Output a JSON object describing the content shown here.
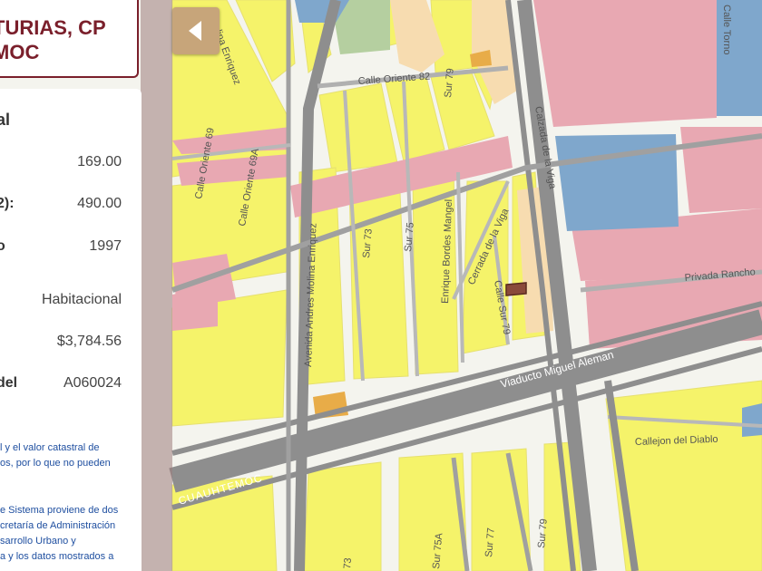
{
  "title": {
    "line1": "TURIAS, CP",
    "line2": "MOC"
  },
  "panel": {
    "heading": "al",
    "rows": [
      {
        "label": "",
        "value": "169.00"
      },
      {
        "label": "2):",
        "value": "490.00"
      },
      {
        "label": "o",
        "value": "1997"
      },
      {
        "label": "",
        "value": "Habitacional"
      },
      {
        "label": "",
        "value": "$3,784.56"
      },
      {
        "label": "del",
        "value": "A060024"
      }
    ],
    "note1": [
      "l y el valor catastral de",
      "os, por lo que no pueden"
    ],
    "note2": [
      "e Sistema proviene de dos",
      "cretaría de Administración",
      "sarrollo Urbano y",
      "a y los datos mostrados a"
    ]
  },
  "map_labels": {
    "calle_oriente_82": "Calle Oriente 82",
    "calle_oriente_69": "Calle Oriente 69",
    "calle_oriente_69a": "Calle Oriente 69A",
    "molina_enriquez_top": "Molina Enriquez",
    "avenida_andres_molina": "Avenida Andres Molina Enriquez",
    "sur_73": "Sur 73",
    "sur_75": "Sur 75",
    "sur_79_top": "Sur 79",
    "enrique_bordes": "Enrique Bordes Mangel",
    "cerrada_viga": "Cerrada de la Viga",
    "calle_sur_79": "Calle Sur 79",
    "calzada_viga": "Calzada de la Viga",
    "privada_rancho": "Privada Rancho",
    "viaducto": "Viaducto Miguel Aleman",
    "callejon_diablo": "Callejon del Diablo",
    "cuauhtemoc": "CUAUHTEMOC",
    "calle_torno": "Calle Torno",
    "sur_77": "Sur 77",
    "sur_79_bottom": "Sur 79",
    "sur_73_bottom": "73",
    "sur_75a_bottom": "Sur 75A"
  },
  "colors": {
    "residential": "#f5f36a",
    "commercial": "#e8a8b2",
    "institutional": "#7fa7cc",
    "green": "#b5cfa0",
    "orange_parcel": "#e8ac48",
    "light_orange": "#f7dcb0",
    "road": "#8e8e8e",
    "accent": "#7a1f2b",
    "button": "#c7a57a"
  }
}
